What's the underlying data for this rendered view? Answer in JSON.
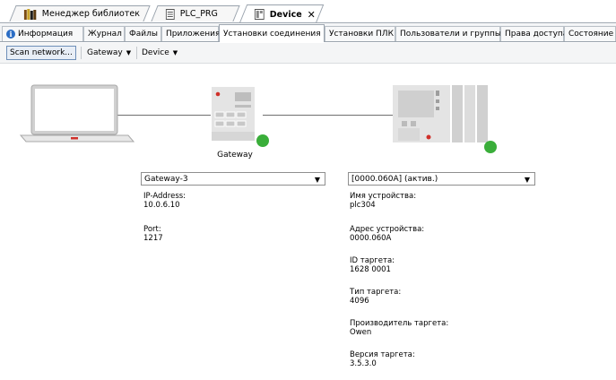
{
  "document_tabs": [
    {
      "label": "Менеджер библиотек",
      "icon": "library-books-icon"
    },
    {
      "label": "PLC_PRG",
      "icon": "document-icon"
    },
    {
      "label": "Device",
      "icon": "device-icon",
      "active": true
    }
  ],
  "device_tabs": [
    {
      "label": "Информация"
    },
    {
      "label": "Журнал"
    },
    {
      "label": "Файлы"
    },
    {
      "label": "Приложения"
    },
    {
      "label": "Установки соединения",
      "active": true
    },
    {
      "label": "Установки ПЛК"
    },
    {
      "label": "Пользователи и группы"
    },
    {
      "label": "Права доступа"
    },
    {
      "label": "Состояние"
    }
  ],
  "toolbar": {
    "scan_network": "Scan network...",
    "gateway": "Gateway",
    "device": "Device"
  },
  "gateway": {
    "caption": "Gateway",
    "selected": "Gateway-3",
    "ip_label": "IP-Address:",
    "ip_value": "10.0.6.10",
    "port_label": "Port:",
    "port_value": "1217"
  },
  "device": {
    "selected": "[0000.060A] (актив.)",
    "fields": [
      {
        "label": "Имя устройства:",
        "value": "plc304"
      },
      {
        "label": "Адрес устройства:",
        "value": "0000.060A"
      },
      {
        "label": "ID таргета:",
        "value": "1628 0001"
      },
      {
        "label": "Тип таргета:",
        "value": "4096"
      },
      {
        "label": "Производитель таргета:",
        "value": "Owen"
      },
      {
        "label": "Версия таргета:",
        "value": "3.5.3.0"
      }
    ]
  },
  "colors": {
    "status_ok": "#3aae3a",
    "accent": "#2a6cc4"
  }
}
